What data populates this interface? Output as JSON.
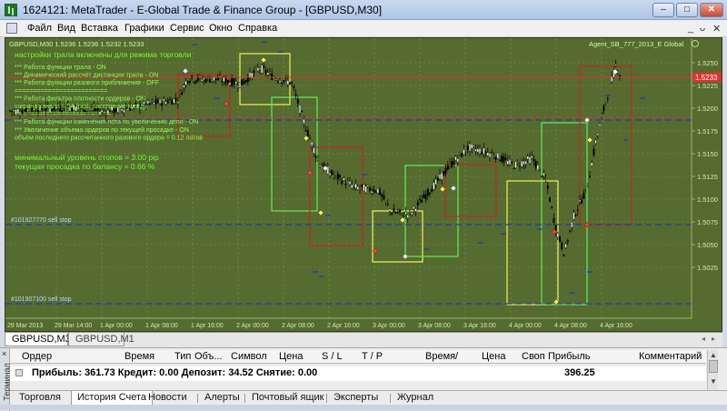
{
  "window": {
    "title": "1624121: MetaTrader - E-Global Trade & Finance Group - [GBPUSD,M30]",
    "minimize": "–",
    "maximize": "□",
    "close": "✕"
  },
  "menu": {
    "items": [
      "Файл",
      "Вид",
      "Вставка",
      "Графики",
      "Сервис",
      "Окно",
      "Справка"
    ],
    "mdi_minimize": "_",
    "mdi_restore": "ᴗ",
    "mdi_close": "✕"
  },
  "chart": {
    "header": "GBPUSD,M30  1.5236 1.5236 1.5232 1.5233",
    "ea_label": "Agent_SB_777_2013_E Global",
    "info_title": "настройки трала включены для режима  торговли",
    "info_lines": [
      "*** Работа функции трала -   ON",
      "*** Динамический рассчёт дистанции трала -   ON",
      "*** Работа функции разового приближения -   OFF",
      "=========================",
      "*** Работа фильтра плотности ордеров -   ON",
      "ширина канала = 54 (pip), расстояние между",
      "== ===================== ==",
      "*** Работа функции изменения лота по увеличению депо -   ON",
      "*** Увеличение объема ордеров по текущей просадке -   ON",
      "объём последнего рассчитанного разового ордера =  0.12 лотов"
    ],
    "stop_level": "минимальный уровень стопов =  3.00 pip",
    "drawdown": "текущая просадка по балансу =  0.66 %",
    "line_labels": [
      "#101927770 sell stop",
      "#101907100 sell stop"
    ],
    "current_price": "1.5233",
    "price_labels": [
      "1.5250",
      "1.5225",
      "1.5200",
      "1.5175",
      "1.5150",
      "1.5125",
      "1.5100",
      "1.5075",
      "1.5050",
      "1.5025"
    ],
    "time_labels": [
      "29 Mar 2013",
      "29 Mar 14:00",
      "1 Apr 00:00",
      "1 Apr 08:00",
      "1 Apr 16:00",
      "2 Apr 00:00",
      "2 Apr 08:00",
      "2 Apr 16:00",
      "3 Apr 00:00",
      "3 Apr 08:00",
      "3 Apr 16:00",
      "4 Apr 00:00",
      "4 Apr 08:00",
      "4 Apr 16:00"
    ],
    "colors": {
      "background": "#556b2f",
      "grid": "#7f9552",
      "candles": "#000000",
      "text": "#6cff2a",
      "red_line": "#e53030",
      "blue_line": "#1e3bbf",
      "box_red": "#c7261c",
      "box_green": "#5df05d",
      "box_yellow": "#f2f25c"
    }
  },
  "chart_tabs": [
    "GBPUSD,M30",
    "GBPUSD,M1"
  ],
  "terminal": {
    "side_label": "Терминал",
    "side_close": "×",
    "columns": [
      "Ордер",
      "Время",
      "Тип",
      "Объ...",
      "Символ",
      "Цена",
      "S / L",
      "T / P",
      "Время",
      "/",
      "Цена",
      "Своп",
      "Прибыль",
      "Комментарий"
    ],
    "summary": "Прибыль: 361.73  Кредит: 0.00  Депозит: 34.52  Снятие: 0.00",
    "summary_profit": "396.25",
    "tabs": [
      "Торговля",
      "История Счета",
      "Новости",
      "Алерты",
      "Почтовый ящик",
      "Эксперты",
      "Журнал"
    ]
  }
}
